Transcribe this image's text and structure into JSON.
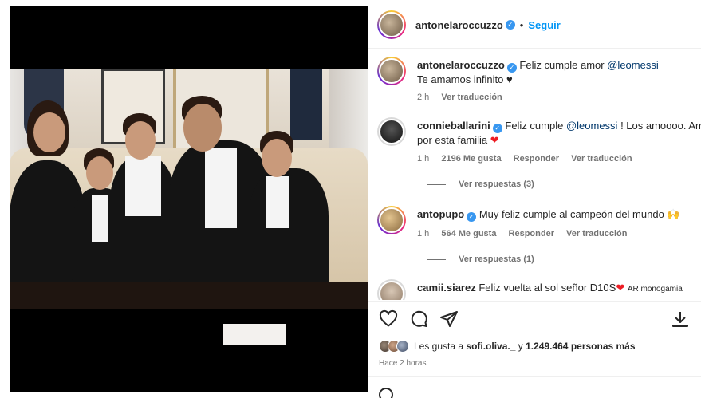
{
  "post": {
    "author": "antonelaroccuzzo",
    "separator": "•",
    "follow_label": "Seguir"
  },
  "caption": {
    "username": "antonelaroccuzzo",
    "text_before": "Feliz cumple amor ",
    "mention": "@leomessi",
    "line2": "Te amamos infinito ♥",
    "time": "2 h",
    "translate": "Ver traducción"
  },
  "comments": [
    {
      "username": "connieballarini",
      "text_before": "Feliz cumple ",
      "mention": "@leomessi",
      "text_after": " ! Los amoooo. Am",
      "line2": "por esta familia",
      "emoji": "❤",
      "time": "1 h",
      "likes": "2196 Me gusta",
      "reply": "Responder",
      "translate": "Ver traducción",
      "view_replies": "Ver respuestas (3)"
    },
    {
      "username": "antopupo",
      "text": "Muy feliz cumple al campeón del mundo",
      "emoji": "🙌",
      "time": "1 h",
      "likes": "564 Me gusta",
      "reply": "Responder",
      "translate": "Ver traducción",
      "view_replies": "Ver respuestas (1)"
    },
    {
      "username": "camii.siarez",
      "text_before": "Feliz vuelta al sol señor D10S",
      "emoji": "❤",
      "text_after": "AR monogamia"
    }
  ],
  "icons": [
    "heart-icon",
    "comment-icon",
    "share-icon",
    "save-icon"
  ],
  "likes_bar": {
    "prefix": "Les gusta a ",
    "user": "sofi.oliva._",
    "middle": " y ",
    "count": "1.249.464 personas más"
  },
  "timestamp": "Hace 2 horas",
  "colors": {
    "accent": "#0095f6",
    "verified": "#3897f0",
    "mention": "#00376b",
    "heart": "#ed1c24"
  }
}
